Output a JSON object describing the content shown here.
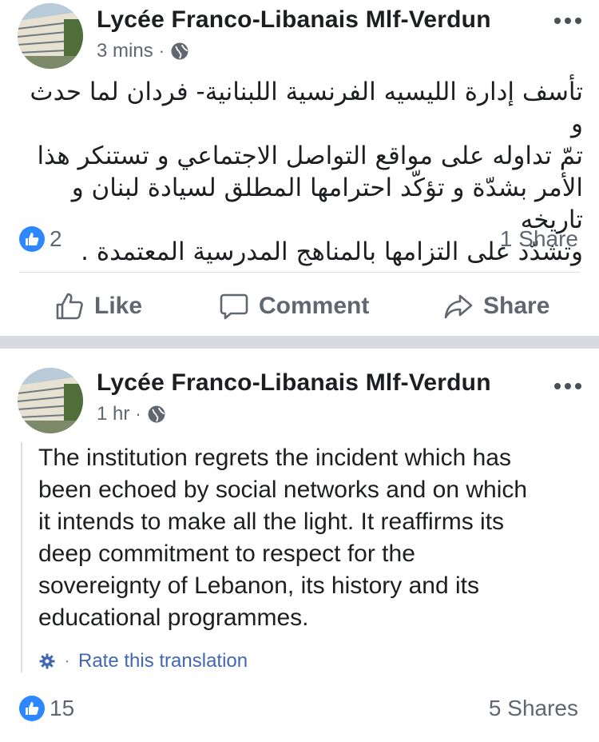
{
  "posts": [
    {
      "page_name": "Lycée Franco-Libanais Mlf-Verdun",
      "time": "3 mins",
      "separator": "·",
      "privacy_icon": "globe-icon",
      "more_icon": "more-options-icon",
      "body_lines": [
        "تأسف إدارة الليسيه الفرنسية اللبنانية- فردان لما حدث و",
        "تمّ تداوله على مواقع التواصل الاجتماعي و تستنكر هذا",
        "الأمر بشدّة و تؤكّد احترامها المطلق لسيادة لبنان و تاريخه",
        "وتشدّد على التزامها بالمناهج المدرسية المعتمدة ."
      ],
      "like_count": "2",
      "shares": "1 Share"
    },
    {
      "page_name": "Lycée Franco-Libanais Mlf-Verdun",
      "time": "1 hr",
      "separator": "·",
      "privacy_icon": "globe-icon",
      "more_icon": "more-options-icon",
      "translation_lines": [
        "The institution regrets the incident which has",
        "been echoed by social networks and on which",
        "it intends to make all the light. It reaffirms its",
        "deep commitment to respect for the",
        "sovereignty of Lebanon, its history and its",
        "educational programmes."
      ],
      "rate_separator": "·",
      "rate_label": "Rate this translation",
      "like_count": "15",
      "shares": "5 Shares"
    }
  ],
  "actions": {
    "like": "Like",
    "comment": "Comment",
    "share": "Share"
  },
  "colors": {
    "like_blue": "#2d88ff",
    "link_blue": "#4267b2",
    "secondary_text": "#606770",
    "separator_gray": "#d8dadf"
  }
}
